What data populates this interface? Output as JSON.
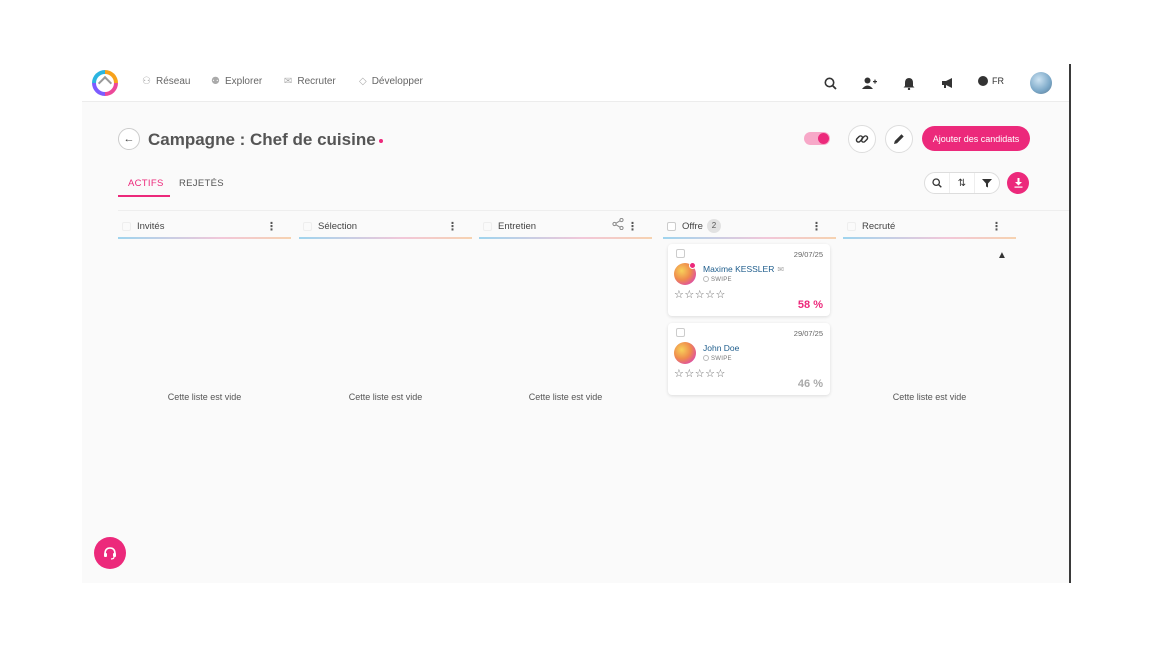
{
  "nav": {
    "items": [
      {
        "label": "Réseau",
        "icon": "network-icon"
      },
      {
        "label": "Explorer",
        "icon": "people-icon"
      },
      {
        "label": "Recruter",
        "icon": "handshake-icon"
      },
      {
        "label": "Développer",
        "icon": "diamond-icon"
      }
    ],
    "language": "FR"
  },
  "header": {
    "title": "Campagne : Chef de cuisine",
    "add_button": "Ajouter des candidats"
  },
  "tabs": [
    {
      "label": "ACTIFS",
      "active": true
    },
    {
      "label": "REJETÉS",
      "active": false
    }
  ],
  "columns": [
    {
      "title": "Invités",
      "empty_text": "Cette liste est vide"
    },
    {
      "title": "Sélection",
      "empty_text": "Cette liste est vide"
    },
    {
      "title": "Entretien",
      "empty_text": "Cette liste est vide"
    },
    {
      "title": "Offre",
      "count": "2"
    },
    {
      "title": "Recruté",
      "empty_text": "Cette liste est vide"
    }
  ],
  "cards": [
    {
      "name": "Maxime KESSLER",
      "date": "29/07/25",
      "source": "SWIPE",
      "score": "58 %",
      "stars": "☆☆☆☆☆"
    },
    {
      "name": "John Doe",
      "date": "29/07/25",
      "source": "SWIPE",
      "score": "46 %",
      "stars": "☆☆☆☆☆"
    }
  ],
  "colors": {
    "accent": "#ec297b",
    "link": "#1e5d8c"
  }
}
